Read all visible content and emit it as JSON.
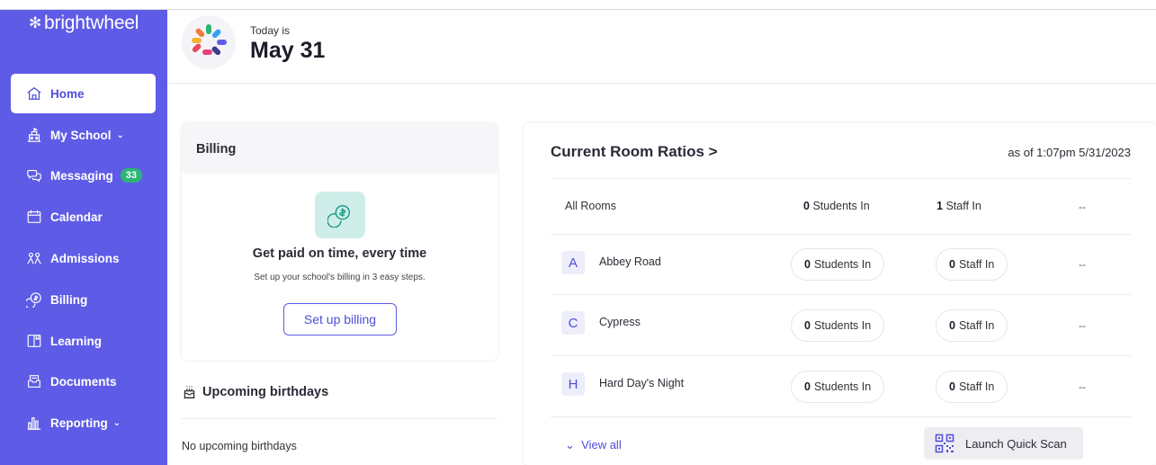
{
  "brand": {
    "name": "brightwheel"
  },
  "sidebar": {
    "items": [
      {
        "label": "Home",
        "icon": "home-icon",
        "active": true
      },
      {
        "label": "My School",
        "icon": "school-icon",
        "chevron": true
      },
      {
        "label": "Messaging",
        "icon": "chat-icon",
        "badge": "33"
      },
      {
        "label": "Calendar",
        "icon": "calendar-icon"
      },
      {
        "label": "Admissions",
        "icon": "admissions-icon"
      },
      {
        "label": "Billing",
        "icon": "billing-icon"
      },
      {
        "label": "Learning",
        "icon": "learning-icon"
      },
      {
        "label": "Documents",
        "icon": "documents-icon"
      },
      {
        "label": "Reporting",
        "icon": "reporting-icon",
        "chevron": true
      }
    ],
    "chevron_glyph": "⌄"
  },
  "header": {
    "today_label": "Today is",
    "date": "May 31"
  },
  "billing": {
    "title": "Billing",
    "heading": "Get paid on time, every time",
    "subtext": "Set up your school's billing in 3 easy steps.",
    "button": "Set up billing"
  },
  "birthdays": {
    "title": "Upcoming birthdays",
    "empty": "No upcoming birthdays"
  },
  "ratios": {
    "title": "Current Room Ratios >",
    "as_of": "as of 1:07pm 5/31/2023",
    "all_rooms": {
      "name": "All Rooms",
      "students_count": "0",
      "students_label": "Students In",
      "staff_count": "1",
      "staff_label": "Staff In",
      "ratio": "--"
    },
    "rooms": [
      {
        "letter": "A",
        "name": "Abbey Road",
        "students_count": "0",
        "students_label": "Students In",
        "staff_count": "0",
        "staff_label": "Staff In",
        "ratio": "--"
      },
      {
        "letter": "C",
        "name": "Cypress",
        "students_count": "0",
        "students_label": "Students In",
        "staff_count": "0",
        "staff_label": "Staff In",
        "ratio": "--"
      },
      {
        "letter": "H",
        "name": "Hard Day's Night",
        "students_count": "0",
        "students_label": "Students In",
        "staff_count": "0",
        "staff_label": "Staff In",
        "ratio": "--"
      }
    ],
    "view_all": "View all",
    "view_all_chevron": "⌄",
    "quick_scan": "Launch Quick Scan"
  },
  "colors": {
    "sidebar": "#5e5ce6",
    "accent": "#4f4dd8",
    "badge": "#2bb673",
    "billing_icon_bg": "#cfeee9"
  }
}
